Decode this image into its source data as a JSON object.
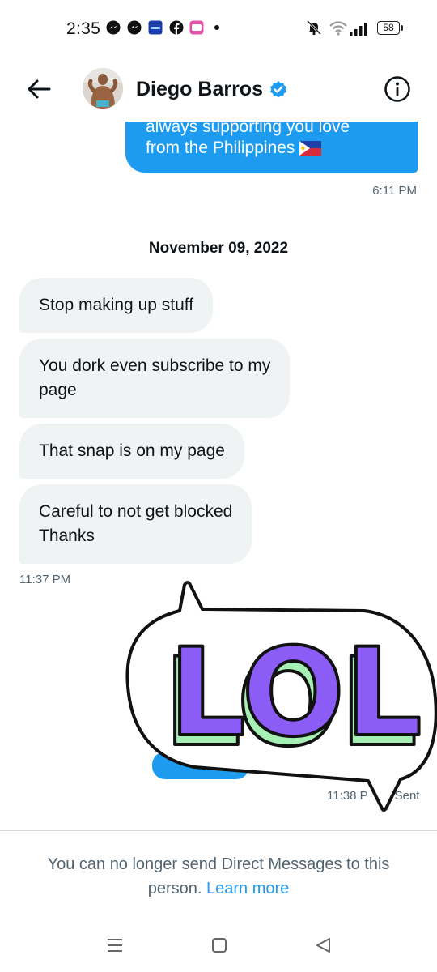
{
  "status_bar": {
    "time": "2:35",
    "battery": "58",
    "icons": [
      "messenger-icon",
      "messenger-icon",
      "app-icon",
      "facebook-icon",
      "app-icon",
      "dot-icon",
      "mute-icon",
      "wifi-icon",
      "signal-icon",
      "battery-icon"
    ]
  },
  "header": {
    "back_icon": "arrow-left-icon",
    "name": "Diego Barros",
    "verified_icon": "verified-badge-icon",
    "info_icon": "info-icon"
  },
  "messages": {
    "outgoing_top": {
      "line1": "always supporting you love",
      "line2": "from the Philippines",
      "flag": "philippines-flag-icon",
      "time": "6:11 PM"
    },
    "date_separator": "November 09, 2022",
    "incoming": [
      "Stop making up stuff",
      "You dork even subscribe to my page",
      "That snap is on my page",
      "Careful to not get blocked Thanks"
    ],
    "incoming_lines": {
      "m2_line1": "You dork even subscribe to my",
      "m2_line2": "page",
      "m4_line1": "Careful to not get blocked",
      "m4_line2": "Thanks"
    },
    "incoming_time": "11:37 PM",
    "sticker": {
      "text": "LOL",
      "time": "11:38 PM",
      "time_visible": "11:38 P",
      "status": "Sent"
    }
  },
  "footer": {
    "notice_line1": "You can no longer send Direct Messages to this",
    "notice_line2": "person.",
    "link": "Learn more"
  },
  "colors": {
    "accent": "#1d9bf0",
    "incoming_bubble": "#eff3f4",
    "muted_text": "#536471",
    "sticker_face": "#8b5cf6",
    "sticker_side": "#a7f0b5"
  },
  "navbar": {
    "icons": [
      "menu-icon",
      "home-icon",
      "back-triangle-icon"
    ]
  }
}
